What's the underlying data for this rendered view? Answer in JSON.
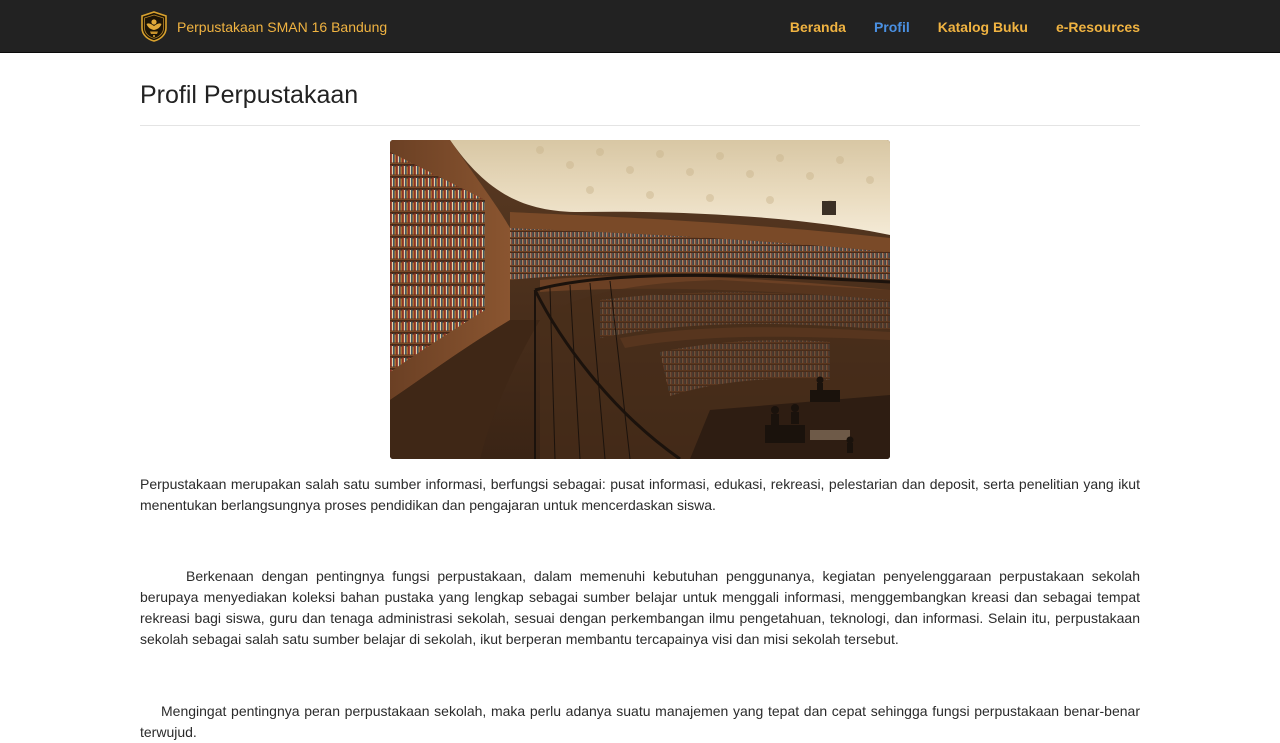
{
  "navbar": {
    "brand_name": "Perpustakaan SMAN 16 Bandung",
    "brand_icon": "school-emblem-icon",
    "links": [
      {
        "label": "Beranda",
        "active": false
      },
      {
        "label": "Profil",
        "active": true
      },
      {
        "label": "Katalog Buku",
        "active": false
      },
      {
        "label": "e-Resources",
        "active": false
      }
    ],
    "colors": {
      "background": "#222222",
      "link": "#f0b341",
      "active_link": "#4a90e2"
    }
  },
  "main": {
    "title": "Profil Perpustakaan",
    "paragraphs": [
      "Perpustakaan merupakan salah satu sumber informasi, berfungsi sebagai: pusat informasi, edukasi, rekreasi, pelestarian dan deposit, serta penelitian yang ikut menentukan berlangsungnya proses pendidikan dan pengajaran untuk mencerdaskan siswa.",
      "Berkenaan dengan pentingnya fungsi perpustakaan, dalam memenuhi kebutuhan penggunanya, kegiatan penyelenggaraan perpustakaan sekolah berupaya menyediakan koleksi bahan pustaka yang lengkap sebagai sumber belajar untuk menggali informasi, menggembangkan kreasi dan sebagai tempat rekreasi bagi siswa, guru dan tenaga administrasi sekolah, sesuai dengan perkembangan ilmu pengetahuan, teknologi, dan informasi. Selain itu, perpustakaan sekolah sebagai salah satu sumber belajar di sekolah, ikut berperan membantu tercapainya visi dan misi sekolah tersebut.",
      "Mengingat pentingnya peran perpustakaan sekolah, maka perlu adanya suatu manajemen yang tepat dan cepat sehingga fungsi perpustakaan benar-benar terwujud."
    ]
  }
}
